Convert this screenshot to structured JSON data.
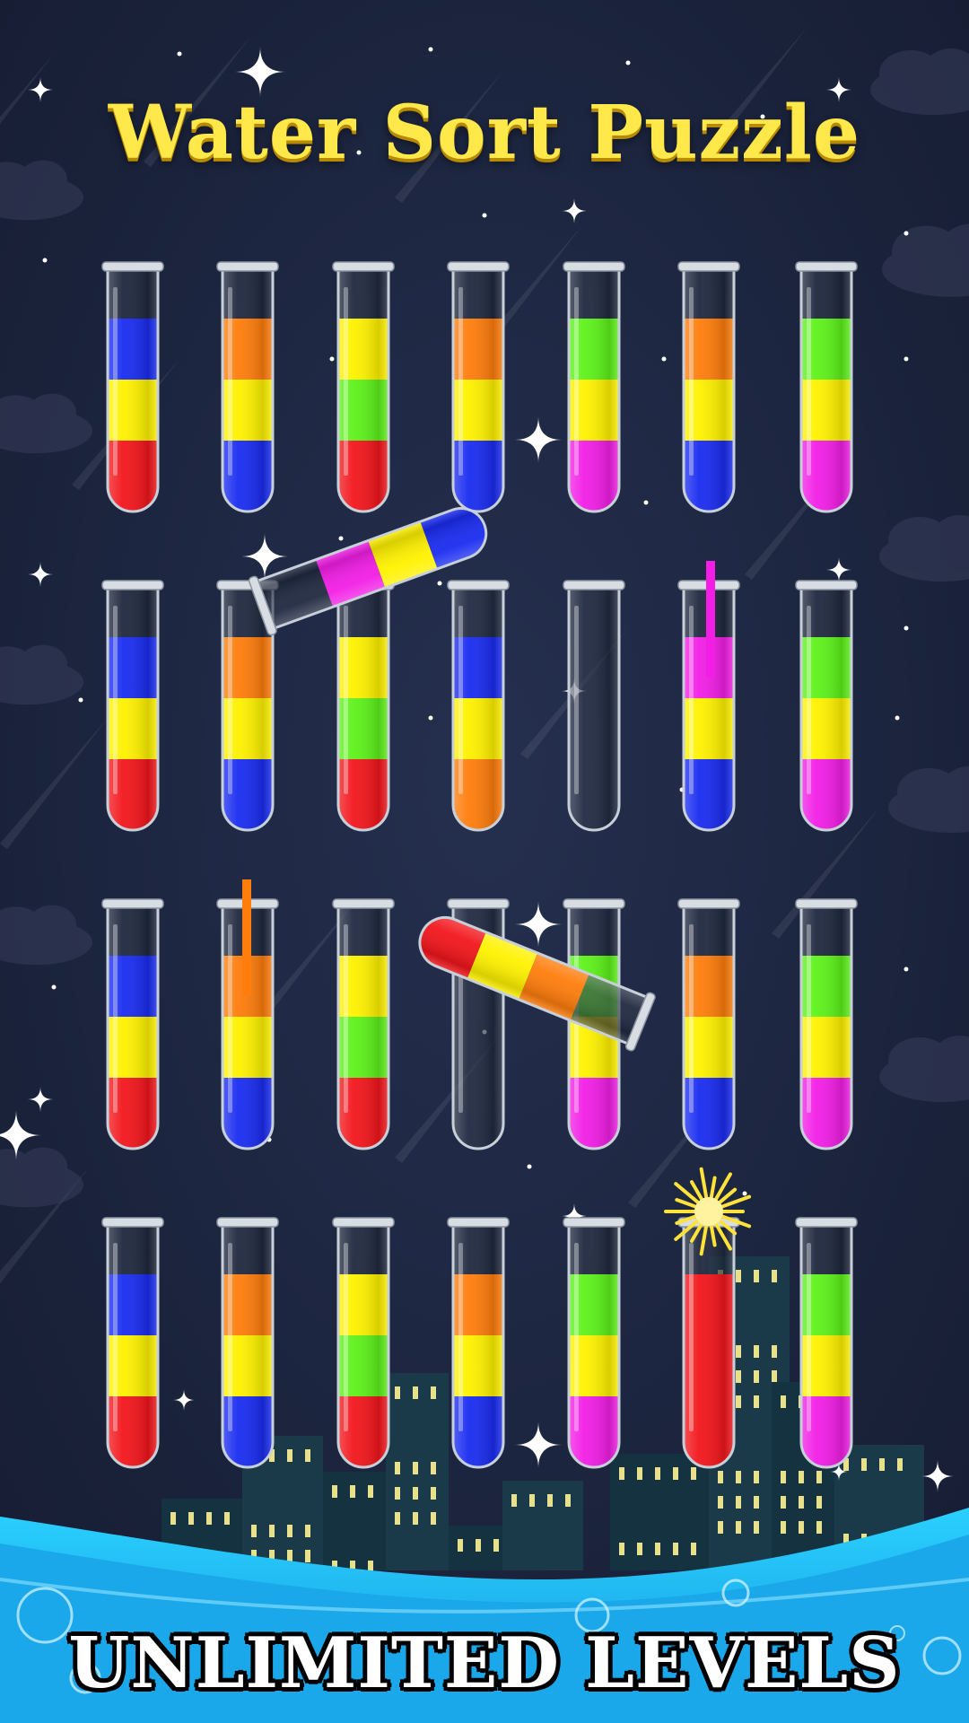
{
  "title": "Water Sort Puzzle",
  "footer": "UNLIMITED LEVELS",
  "colors": {
    "blue": "#1a2cf0",
    "yellow": "#fff200",
    "red": "#f2161c",
    "orange": "#ff7d0c",
    "green": "#5df21a",
    "magenta": "#f21ee6",
    "background": "#1c2540",
    "title": "#ffe84a",
    "water": "#25b6f2"
  },
  "tubes": [
    [
      [
        "blue",
        "yellow",
        "red"
      ],
      [
        "orange",
        "yellow",
        "blue"
      ],
      [
        "yellow",
        "green",
        "red"
      ],
      [
        "orange",
        "yellow",
        "blue"
      ],
      [
        "green",
        "yellow",
        "magenta"
      ],
      [
        "orange",
        "yellow",
        "blue"
      ],
      [
        "green",
        "yellow",
        "magenta"
      ]
    ],
    [
      [
        "blue",
        "yellow",
        "red"
      ],
      [
        "orange",
        "yellow",
        "blue"
      ],
      [
        "yellow",
        "green",
        "red"
      ],
      [
        "blue",
        "yellow",
        "orange"
      ],
      [],
      [
        "magenta",
        "yellow",
        "blue"
      ],
      [
        "green",
        "yellow",
        "magenta"
      ]
    ],
    [
      [
        "blue",
        "yellow",
        "red"
      ],
      [
        "orange",
        "yellow",
        "blue"
      ],
      [
        "yellow",
        "green",
        "red"
      ],
      [],
      [
        "green",
        "yellow",
        "magenta"
      ],
      [
        "orange",
        "yellow",
        "blue"
      ],
      [
        "green",
        "yellow",
        "magenta"
      ]
    ],
    [
      [
        "blue",
        "yellow",
        "red"
      ],
      [
        "orange",
        "yellow",
        "blue"
      ],
      [
        "yellow",
        "green",
        "red"
      ],
      [
        "orange",
        "yellow",
        "blue"
      ],
      [
        "green",
        "yellow",
        "magenta"
      ],
      [
        "red",
        "red",
        "red"
      ],
      [
        "green",
        "yellow",
        "magenta"
      ]
    ]
  ],
  "pouring_tubes": [
    {
      "from_row": 1,
      "from_col": 4,
      "layers": [
        "blue",
        "yellow",
        "magenta"
      ],
      "stream": "magenta"
    },
    {
      "from_row": 2,
      "from_col": 3,
      "layers": [
        "red",
        "yellow",
        "orange"
      ],
      "stream": "orange"
    }
  ],
  "sparkle_tube": {
    "row": 3,
    "col": 5
  }
}
